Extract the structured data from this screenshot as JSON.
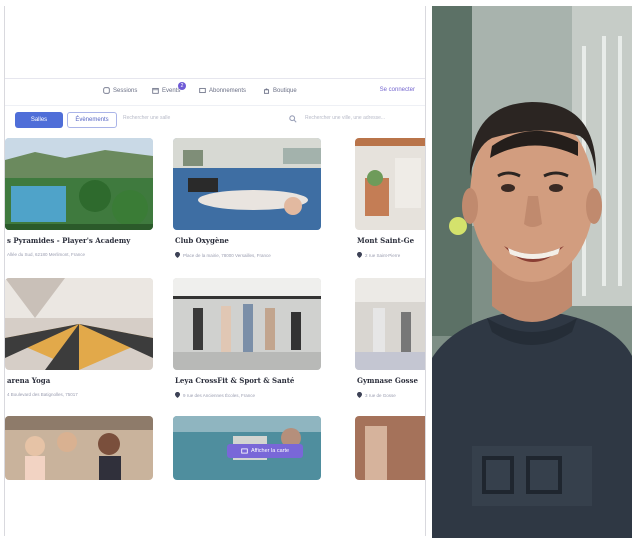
{
  "nav": {
    "items": [
      {
        "label": "Sessions",
        "icon": "tag-icon"
      },
      {
        "label": "Events",
        "icon": "calendar-icon",
        "badge": "2"
      },
      {
        "label": "Abonnements",
        "icon": "card-icon"
      },
      {
        "label": "Boutique",
        "icon": "bag-icon"
      }
    ],
    "login": "Se connecter"
  },
  "filters": {
    "active_tab": "Salles",
    "second_tab": "Évènements",
    "search_placeholder": "Rechercher une salle",
    "location_placeholder": "Rechercher une ville, une adresse..."
  },
  "cards": [
    {
      "title": "s Pyramides - Player's Academy",
      "address": "Allée du Sud, 62180 Merlimont, France"
    },
    {
      "title": "Club Oxygène",
      "address": "Place de la mairie, 78000 Versailles, France"
    },
    {
      "title": "Mont Saint-Ge",
      "address": "2 rue Saint-Pierre"
    },
    {
      "title": "arena Yoga",
      "address": "4 Boulevard des Batignolles, 75017"
    },
    {
      "title": "Leya CrossFit & Sport & Santé",
      "address": "9 rue des Anciennes Écoles, France"
    },
    {
      "title": "Gymnase Gosse",
      "address": "3 rue de Gosse"
    }
  ],
  "cta": {
    "label": "Afficher la carte"
  }
}
